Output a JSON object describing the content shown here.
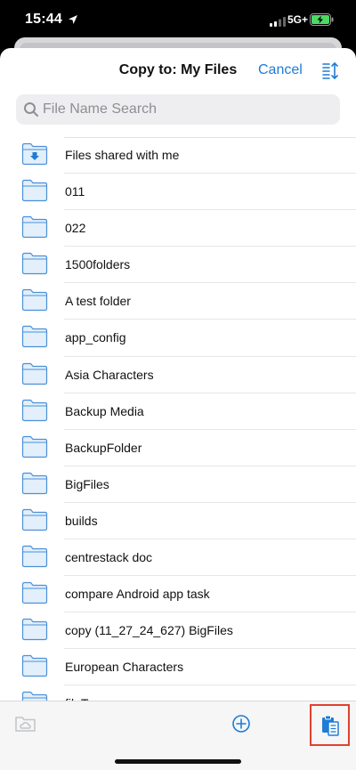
{
  "status_bar": {
    "time": "15:44",
    "network": "5G+",
    "battery_charging": true
  },
  "nav": {
    "title": "Copy to: My Files",
    "cancel_label": "Cancel",
    "sort_icon": "sort-icon"
  },
  "search": {
    "placeholder": "File Name Search",
    "value": ""
  },
  "files": [
    {
      "name": "Files shared with me",
      "icon": "shared-folder-icon"
    },
    {
      "name": "011",
      "icon": "folder-icon"
    },
    {
      "name": "022",
      "icon": "folder-icon"
    },
    {
      "name": "1500folders",
      "icon": "folder-icon"
    },
    {
      "name": "A test folder",
      "icon": "folder-icon"
    },
    {
      "name": "app_config",
      "icon": "folder-icon"
    },
    {
      "name": "Asia Characters",
      "icon": "folder-icon"
    },
    {
      "name": "Backup Media",
      "icon": "folder-icon"
    },
    {
      "name": "BackupFolder",
      "icon": "folder-icon"
    },
    {
      "name": "BigFiles",
      "icon": "folder-icon"
    },
    {
      "name": "builds",
      "icon": "folder-icon"
    },
    {
      "name": "centrestack doc",
      "icon": "folder-icon"
    },
    {
      "name": "compare Android app task",
      "icon": "folder-icon"
    },
    {
      "name": "copy (11_27_24_627) BigFiles",
      "icon": "folder-icon"
    },
    {
      "name": "European Characters",
      "icon": "folder-icon"
    },
    {
      "name": "fileTypes",
      "icon": "folder-icon"
    }
  ],
  "toolbar": {
    "new_folder_icon": "new-cloud-folder-icon",
    "add_icon": "add-circle-icon",
    "paste_icon": "paste-clipboard-icon"
  },
  "colors": {
    "accent": "#1e7cd6",
    "folder_fill": "#e3effa",
    "folder_stroke": "#4a90d9",
    "highlight": "#e0402e"
  }
}
